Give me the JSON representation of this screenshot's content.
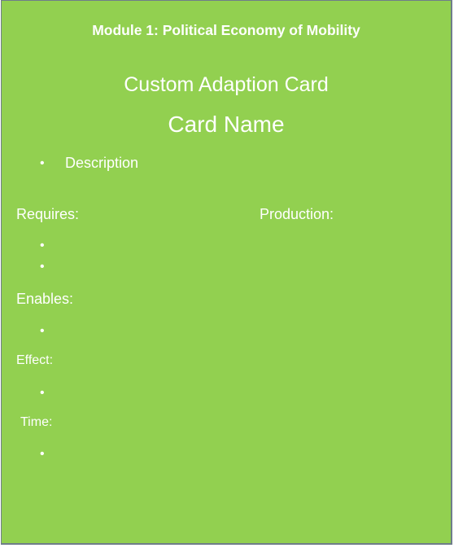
{
  "module_title": "Module 1: Political Economy of Mobility",
  "card_type": "Custom Adaption Card",
  "card_name": "Card Name",
  "description": "Description",
  "requires_label": "Requires:",
  "production_label": "Production:",
  "enables_label": "Enables:",
  "effect_label": "Effect:",
  "time_label": "Time:",
  "bullet_glyph": "•",
  "colors": {
    "card_background": "#92d050",
    "text": "#ffffff",
    "border": "#6f7d8a"
  }
}
